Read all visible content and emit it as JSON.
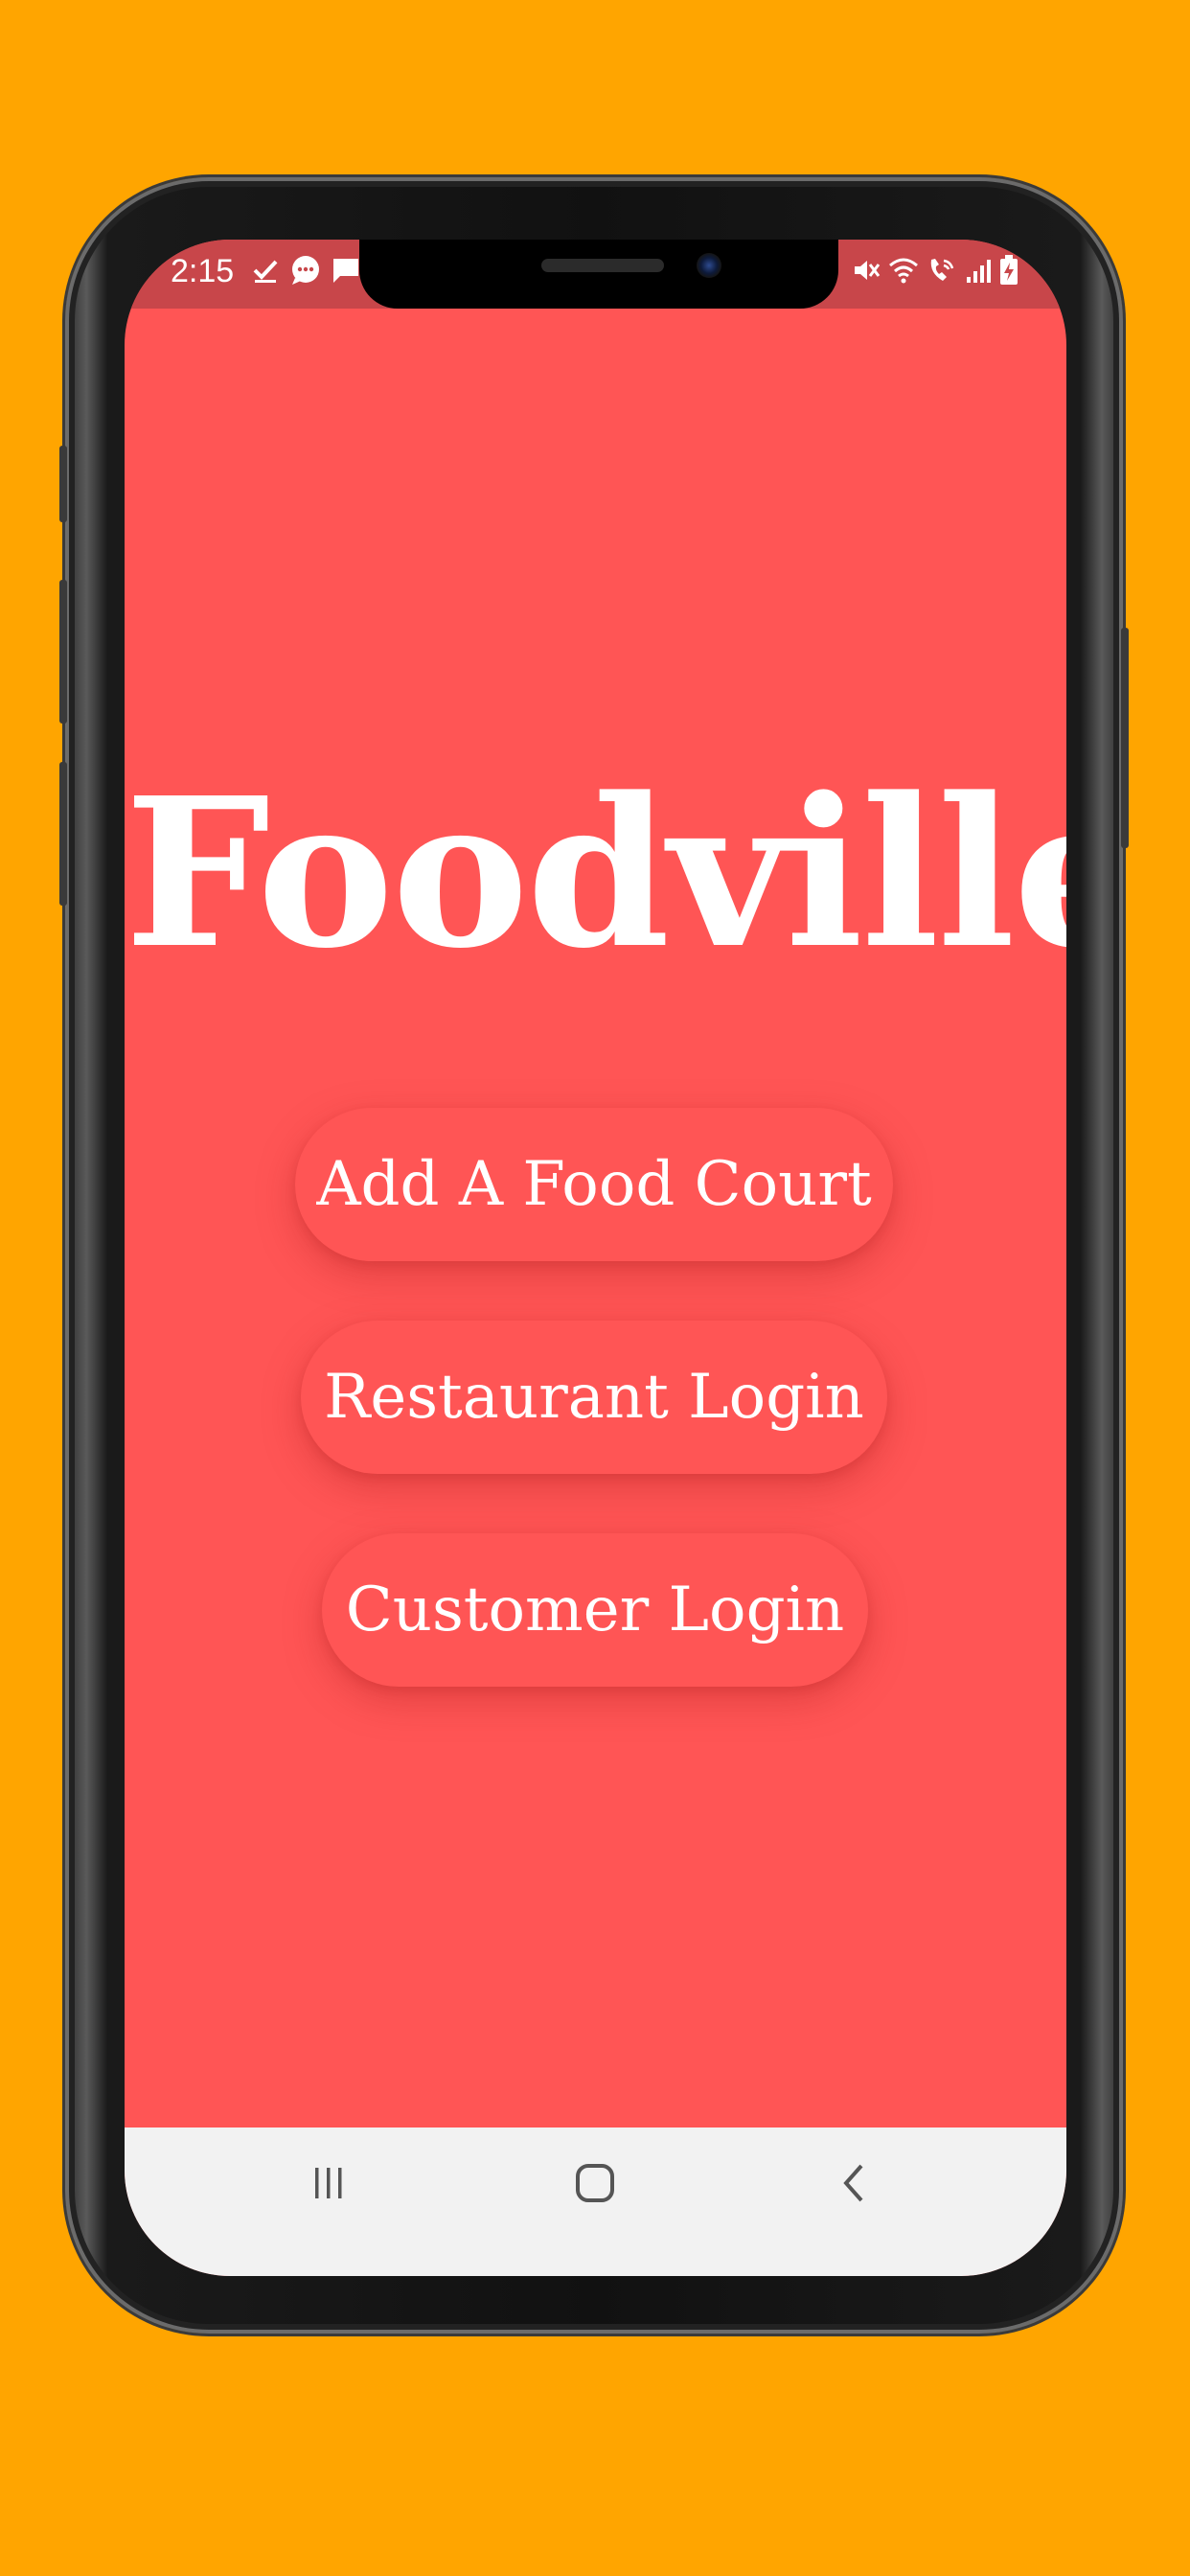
{
  "status_bar": {
    "time": "2:15",
    "left_icons": [
      "check-icon",
      "chat-bubble-icon",
      "message-icon"
    ],
    "right_icons": [
      "mute-icon",
      "wifi-icon",
      "wifi-call-icon",
      "signal-icon",
      "battery-charging-icon"
    ]
  },
  "app": {
    "title": "Foodville",
    "buttons": {
      "add_food_court": "Add A Food Court",
      "restaurant_login": "Restaurant Login",
      "customer_login": "Customer Login"
    }
  },
  "nav_bar": {
    "items": [
      "recents-icon",
      "home-icon",
      "back-icon"
    ]
  },
  "colors": {
    "background": "#FFA500",
    "app_background": "#FF5555",
    "status_bar": "#C8464A",
    "nav_bar": "#F2F2F2",
    "text": "#FFFFFF"
  }
}
